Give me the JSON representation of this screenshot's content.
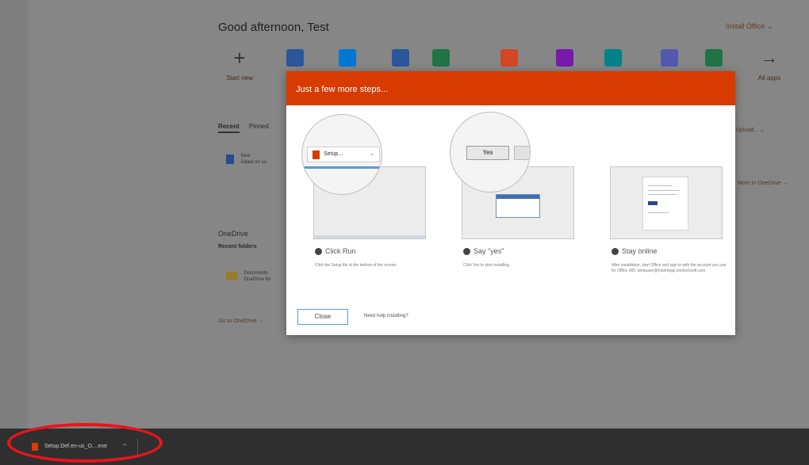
{
  "background": {
    "greeting": "Good afternoon, Test",
    "install_office": "Install Office ⌄",
    "apps": [
      {
        "label": "Start new",
        "color": "",
        "icon": "plus-icon"
      },
      {
        "label": "",
        "color": "#2b579a",
        "icon": "outlook-icon"
      },
      {
        "label": "",
        "color": "#0078d4",
        "icon": "onedrive-icon"
      },
      {
        "label": "",
        "color": "#2b579a",
        "icon": "word-icon"
      },
      {
        "label": "",
        "color": "#217346",
        "icon": "excel-icon"
      },
      {
        "label": "",
        "color": "#d24726",
        "icon": "powerpoint-icon"
      },
      {
        "label": "",
        "color": "#7719aa",
        "icon": "onenote-icon"
      },
      {
        "label": "",
        "color": "#038387",
        "icon": "sharepoint-icon"
      },
      {
        "label": "",
        "color": "#5558af",
        "icon": "teams-icon"
      },
      {
        "label": "",
        "color": "#217346",
        "icon": "sway-icon"
      },
      {
        "label": "All apps",
        "color": "",
        "icon": "arrow-right-icon"
      }
    ],
    "tabs": [
      "Recent",
      "Pinned"
    ],
    "recent_file": {
      "name": "New",
      "location": "Dated on so"
    },
    "onedrive_heading": "OneDrive",
    "recent_folders": "Recent folders",
    "folder": {
      "name": "Documents",
      "location": "OneDrive for"
    },
    "goto_onedrive": "Go to OneDrive  →",
    "side_link_upload": "Upload...  ⌄",
    "side_link_more": "More in OneDrive  →"
  },
  "modal": {
    "header": "Just a few more steps...",
    "steps": [
      {
        "title": "Click Run",
        "desc": "Click the Setup file at the bottom of the screen."
      },
      {
        "title": "Say \"yes\"",
        "desc": "Click Yes to start installing."
      },
      {
        "title": "Stay online",
        "desc": "After installation, start Office and sign in with the account you use for Office 365: tempuser@maxmegs.onmicrosoft.com"
      }
    ],
    "zoom_download_label": "Setup...",
    "zoom_yes_label": "Yes",
    "close_label": "Close",
    "help_link": "Need help installing?"
  },
  "download_bar": {
    "file_name": "Setup.Def.en-us_O....exe",
    "chevron": "⌃"
  },
  "colors": {
    "office_orange": "#d83b01",
    "highlight_red": "#e8141b"
  }
}
